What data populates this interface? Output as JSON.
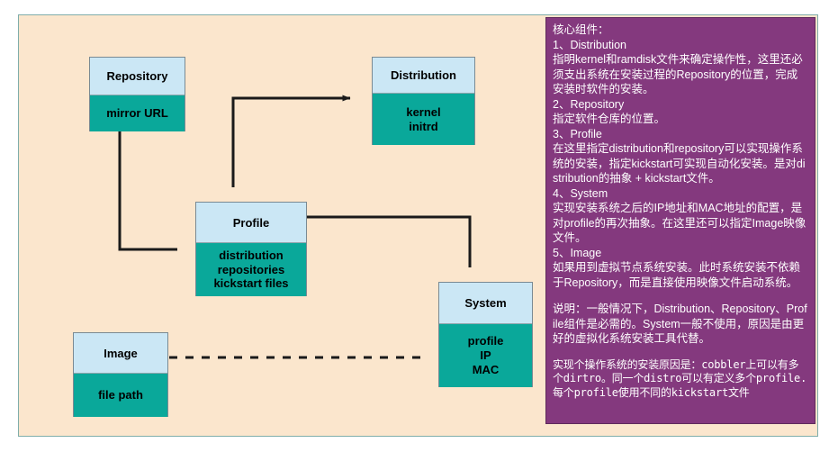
{
  "diagram": {
    "title": "Cobbler core components relationship diagram",
    "colors": {
      "canvas_background": "#fbe6cd",
      "node_header": "#cbe7f5",
      "node_body": "#0aa89a",
      "notes_panel": "#84397e",
      "connector": "#1a1a1a"
    },
    "nodes": [
      {
        "id": "repository",
        "title": "Repository",
        "attributes": [
          "mirror URL"
        ]
      },
      {
        "id": "distribution",
        "title": "Distribution",
        "attributes": [
          "kernel",
          "initrd"
        ]
      },
      {
        "id": "profile",
        "title": "Profile",
        "attributes": [
          "distribution",
          "repositories",
          "kickstart files"
        ]
      },
      {
        "id": "system",
        "title": "System",
        "attributes": [
          "profile",
          "IP",
          "MAC"
        ]
      },
      {
        "id": "image",
        "title": "Image",
        "attributes": [
          "file path"
        ]
      }
    ],
    "edges": [
      {
        "from": "profile",
        "to": "repository",
        "style": "solid",
        "arrow": "end"
      },
      {
        "from": "profile",
        "to": "distribution",
        "style": "solid",
        "arrow": "end"
      },
      {
        "from": "system",
        "to": "profile",
        "style": "solid",
        "arrow": "end"
      },
      {
        "from": "system",
        "to": "image",
        "style": "dashed",
        "arrow": "end"
      }
    ]
  },
  "notes": {
    "heading": "核心组件：",
    "paragraphs": [
      "1、Distribution",
      "指明kernel和ramdisk文件来确定操作性，这里还必须支出系统在安装过程的Repository的位置，完成安装时软件的安装。",
      "2、Repository",
      "指定软件仓库的位置。",
      "3、Profile",
      "在这里指定distribution和repository可以实现操作系统的安装，指定kickstart可实现自动化安装。是对distribution的抽象 + kickstart文件。",
      "4、System",
      "实现安装系统之后的IP地址和MAC地址的配置，是对profile的再次抽象。在这里还可以指定Image映像文件。",
      "5、Image",
      "如果用到虚拟节点系统安装。此时系统安装不依赖于Repository，而是直接使用映像文件启动系统。"
    ],
    "explanation": "说明：一般情况下，Distribution、Repository、Profile组件是必需的。System一般不使用，原因是由更好的虚拟化系统安装工具代替。",
    "summary": "实现个操作系统的安装原因是：cobbler上可以有多个dirtro。同一个distro可以有定义多个profile.每个profile使用不同的kickstart文件"
  }
}
